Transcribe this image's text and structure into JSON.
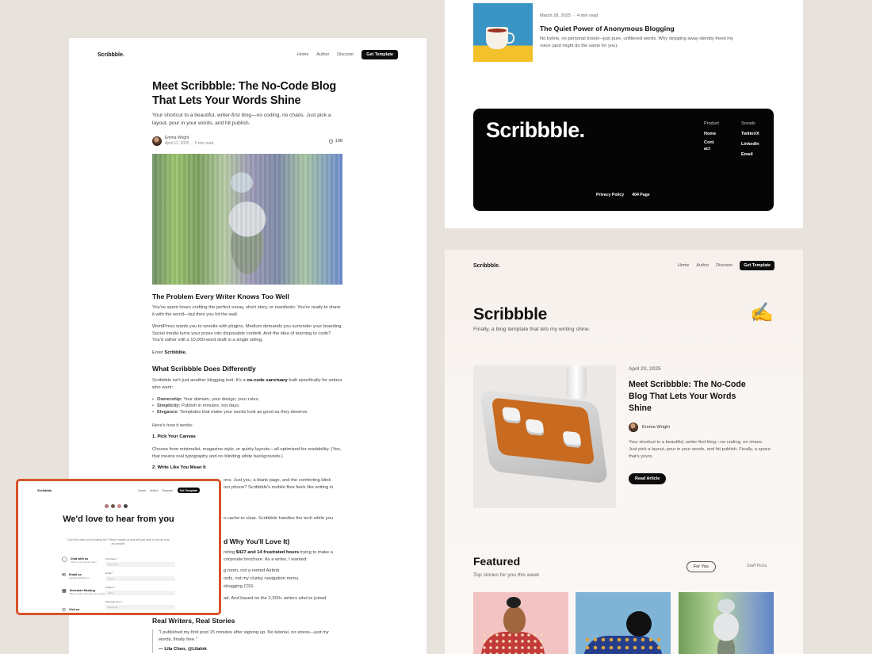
{
  "article_page": {
    "logo": "Scribbble.",
    "nav": [
      "Home",
      "Author",
      "Discover"
    ],
    "cta": "Get Template",
    "title": "Meet Scribbble: The No-Code Blog That Lets Your Words Shine",
    "lede": "Your shortcut to a beautiful, writer-first blog—no coding, no chaos. Just pick a layout, pour in your words, and hit publish.",
    "author": "Emma Wright",
    "date": "April 11, 2025",
    "read_time": "5 min read",
    "likes": "108",
    "h_problem": "The Problem Every Writer Knows Too Well",
    "p1": "You've spent hours crafting the perfect essay, short story, or manifesto. You're ready to share it with the world—but then you hit the wall.",
    "p2": "WordPress wants you to wrestle with plugins. Medium demands you surrender your branding. Social media turns your prose into disposable confetti. And the idea of learning to code? You'd rather edit a 10,000-word draft in a single sitting.",
    "p3_prefix": "Enter ",
    "p3_bold": "Scribbble.",
    "h_diff": "What Scribbble Does Differently",
    "p4_a": "Scribbble isn't just another blogging tool. It's a ",
    "p4_bold": "no-code sanctuary",
    "p4_b": " built specifically for writers who want:",
    "bullets": [
      {
        "b": "Ownership:",
        "t": " Your domain, your design, your rules."
      },
      {
        "b": "Simplicity:",
        "t": " Publish in minutes, not days."
      },
      {
        "b": "Elegance:",
        "t": " Templates that make your words look as good as they deserve."
      }
    ],
    "p5": "Here's how it works:",
    "h_step1": "1. Pick Your Canvas",
    "p6": "Choose from minimalist, magazine-style, or quirky layouts—all optimized for readability. (Yes, that means real typography and no blinding white backgrounds.)",
    "h_step2": "2. Write Like You Mean It",
    "p7_frag": "ons. Just you, a blank page, and the comforting blink",
    "p7b_frag": "our phone? Scribbble's mobile flow feels like writing in",
    "p8_frag": "o cache to clear. Scribbble handles the tech while you",
    "h_why_frag": "d Why You'll Love It)",
    "p9_frag_a": "nding ",
    "p9_frag_bold": "$427 and 14 frustrated hours",
    "p9_frag_b": " trying to make a",
    "p9b_frag": "corporate brochure. As a writer, I wanted:",
    "p10_frag": "g room, not a rented Airbnb.",
    "p11_frag": "ords, not my clunky navigation menu.",
    "p12_frag": "ebugging CSS.",
    "p13_frag": "ad. And based on the 2,300+ writers who've joined",
    "h_real": "Real Writers, Real Stories",
    "quote": "\"I published my first post 15 minutes after signing up. No tutorial, no stress—just my words, finally free.\"",
    "quote_author": "— Lila Chen, @Lilalnk"
  },
  "contact_card": {
    "logo": "Scribbble.",
    "nav": [
      "Home",
      "Author",
      "Discover"
    ],
    "cta": "Get Template",
    "title": "We'd love to hear from you",
    "subtitle": "Can't find what you're looking for? Please contact us and we'll get back to you as soon as possible.",
    "options": [
      {
        "title": "Chat with us",
        "sub": "Chat to our friendly team"
      },
      {
        "title": "Email us",
        "sub": "hello@scribbble.co"
      },
      {
        "title": "Schedule Meeting",
        "sub": "Book a call to discuss your needs"
      },
      {
        "title": "Visit us",
        "sub": ""
      }
    ],
    "fields": [
      {
        "label": "Full Name *",
        "placeholder": "Full name"
      },
      {
        "label": "Email *",
        "placeholder": "Email"
      },
      {
        "label": "Subject *",
        "placeholder": "Enter"
      },
      {
        "label": "Message Here *",
        "placeholder": "Message"
      }
    ]
  },
  "list_item": {
    "date": "March 28, 2025",
    "read_time": "4 min read",
    "title": "The Quiet Power of Anonymous Blogging",
    "desc": "No byline, no personal brand—just pure, unfiltered words. Why stripping away identity freed my voice (and might do the same for you)."
  },
  "footer": {
    "logo": "Scribbble.",
    "product_heading": "Product",
    "product_items": [
      "Home",
      "Cont\nact"
    ],
    "socials_heading": "Socials",
    "social_items": [
      "Twitter/X",
      "LinkedIn",
      "Email"
    ],
    "bottom_links": [
      "Privacy Policy",
      "404 Page"
    ]
  },
  "homepage": {
    "logo": "Scribbble.",
    "nav": [
      "Home",
      "Author",
      "Discover"
    ],
    "cta": "Get Template",
    "title": "Scribbble",
    "subtitle": "Finally, a blog template that lets my writing shine.",
    "hand_emoji": "✍️",
    "featured": {
      "date": "April 20, 2025",
      "title": "Meet Scribbble: The No-Code Blog That Lets Your Words Shine",
      "author": "Emma Wright",
      "desc": "Your shortcut to a beautiful, writer-first blog—no coding, no chaos. Just pick a layout, pour in your words, and hit publish. Finally, a space that's yours.",
      "button": "Read Article"
    },
    "section_title": "Featured",
    "section_sub": "Top stories for you this week",
    "pills": [
      "For You",
      "Staff Picks"
    ]
  }
}
